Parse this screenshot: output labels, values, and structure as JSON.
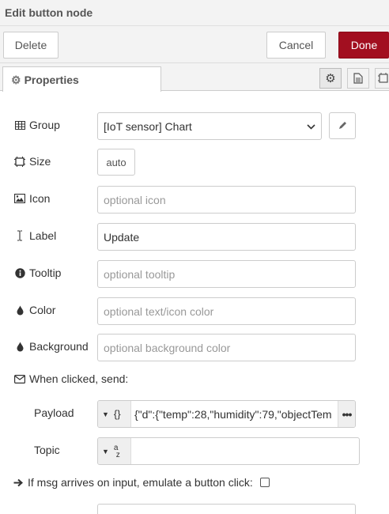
{
  "header": {
    "title": "Edit button node"
  },
  "actions": {
    "delete_label": "Delete",
    "cancel_label": "Cancel",
    "done_label": "Done"
  },
  "tabs": {
    "properties_label": "Properties"
  },
  "form": {
    "group": {
      "label": "Group",
      "value": "[IoT sensor] Chart"
    },
    "size": {
      "label": "Size",
      "value": "auto"
    },
    "icon": {
      "label": "Icon",
      "placeholder": "optional icon"
    },
    "label": {
      "label": "Label",
      "value": "Update"
    },
    "tooltip": {
      "label": "Tooltip",
      "placeholder": "optional tooltip"
    },
    "color": {
      "label": "Color",
      "placeholder": "optional text/icon color"
    },
    "background": {
      "label": "Background",
      "placeholder": "optional background color"
    },
    "when_clicked": {
      "label": "When clicked, send:"
    },
    "payload": {
      "label": "Payload",
      "type_glyph": "{}",
      "value": "{\"d\":{\"temp\":28,\"humidity\":79,\"objectTem"
    },
    "topic": {
      "label": "Topic",
      "type_glyph": "az",
      "value": ""
    },
    "emulate": {
      "label": "If msg arrives on input, emulate a button click:"
    }
  }
}
